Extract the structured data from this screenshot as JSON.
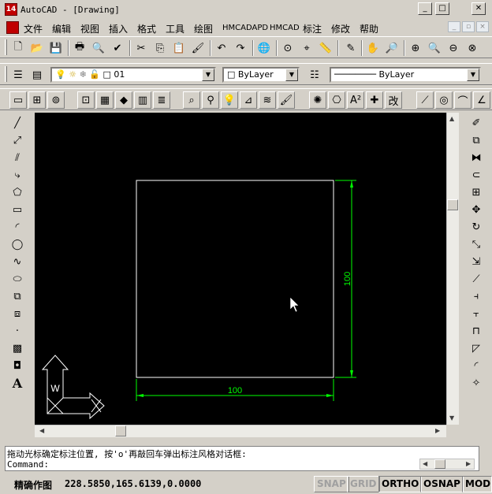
{
  "window": {
    "app_icon_text": "14",
    "title": "AutoCAD - [Drawing]"
  },
  "menubar": {
    "items": [
      "文件",
      "编辑",
      "视图",
      "插入",
      "格式",
      "工具",
      "绘图",
      "HMCADAPD",
      "HMCAD",
      "标注",
      "修改",
      "帮助"
    ]
  },
  "layers_toolbar": {
    "layer_value": "01",
    "color_value": "ByLayer",
    "linetype_value": "ByLayer"
  },
  "drawing": {
    "dimension_horizontal": "100",
    "dimension_vertical": "100",
    "ucs_label": "W",
    "colors": {
      "background": "#000000",
      "geometry": "#ffffff",
      "dimension": "#00ff00"
    }
  },
  "command": {
    "prompt_line": "拖动光标确定标注位置, 按'o'再敲回车弹出标注风格对话框:",
    "input_line": "Command:"
  },
  "status": {
    "mode": "精确作图",
    "coordinates": "228.5850,165.6139,0.0000",
    "toggles": [
      {
        "label": "SNAP",
        "on": false
      },
      {
        "label": "GRID",
        "on": false
      },
      {
        "label": "ORTHO",
        "on": true
      },
      {
        "label": "OSNAP",
        "on": true
      },
      {
        "label": "MODE",
        "on": true
      }
    ]
  }
}
